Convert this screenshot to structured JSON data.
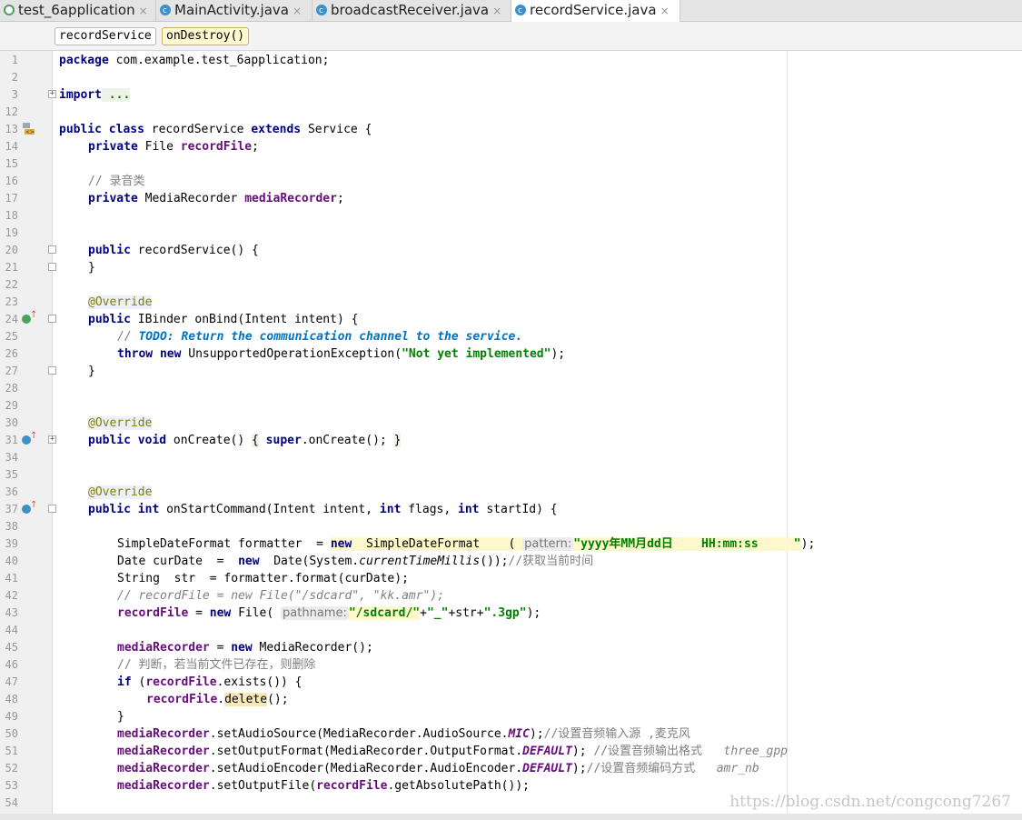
{
  "tabs": [
    {
      "label": "test_6application",
      "close": "×"
    },
    {
      "label": "MainActivity.java",
      "close": "×"
    },
    {
      "label": "broadcastReceiver.java",
      "close": "×"
    },
    {
      "label": "recordService.java",
      "close": "×"
    }
  ],
  "breadcrumb": [
    "recordService",
    "onDestroy()"
  ],
  "line_numbers": [
    "1",
    "2",
    "3",
    "12",
    "13",
    "14",
    "15",
    "16",
    "17",
    "18",
    "19",
    "20",
    "21",
    "22",
    "23",
    "24",
    "25",
    "26",
    "27",
    "28",
    "29",
    "30",
    "31",
    "34",
    "35",
    "36",
    "37",
    "38",
    "39",
    "40",
    "41",
    "42",
    "43",
    "44",
    "45",
    "46",
    "47",
    "48",
    "49",
    "50",
    "51",
    "52",
    "53",
    "54"
  ],
  "code": {
    "l1_kw": "package",
    "l1_rest": " com.example.test_6application;",
    "l3_kw": "import",
    "l3_rest": " ...",
    "l13_a": "public class",
    "l13_b": " recordService ",
    "l13_c": "extends",
    "l13_d": " Service {",
    "l14_kw": "private",
    "l14_type": " File ",
    "l14_fld": "recordFile",
    "l14_end": ";",
    "l16_cmt": "// 录音类",
    "l17_kw": "private",
    "l17_type": " MediaRecorder ",
    "l17_fld": "mediaRecorder",
    "l17_end": ";",
    "l20_kw": "public",
    "l20_rest": " recordService() {",
    "l21": "}",
    "l23_ann": "@Override",
    "l24_kw": "public",
    "l24_rest": " IBinder onBind(Intent intent) {",
    "l25_slash": "// ",
    "l25_todo": "TODO: Return the communication channel to the service.",
    "l26_kw1": "throw",
    "l26_kw2": " new",
    "l26_mid": " UnsupportedOperationException(",
    "l26_str": "\"Not yet implemented\"",
    "l26_end": ");",
    "l27": "}",
    "l30_ann": "@Override",
    "l31_kw": "public void",
    "l31_rest": " onCreate() ",
    "l31_b1": "{",
    "l31_sp": " ",
    "l31_super": "super",
    "l31_call": ".onCreate(); ",
    "l31_b2": "}",
    "l36_ann": "@Override",
    "l37_kw": "public int",
    "l37_a": " onStartCommand(Intent intent, ",
    "l37_kw2": "int",
    "l37_b": " flags, ",
    "l37_kw3": "int",
    "l37_c": " startId) {",
    "l39_a": "SimpleDateFormat formatter  = ",
    "l39_new": "new",
    "l39_b": "  SimpleDateFormat    ( ",
    "l39_hint": "pattern:",
    "l39_str": "\"yyyy年MM月dd日    HH:mm:ss     \"",
    "l39_end": ");",
    "l40_a": "Date curDate  =  ",
    "l40_new": "new",
    "l40_b": "  Date(System.",
    "l40_st": "currentTimeMillis",
    "l40_c": "());",
    "l40_cmt": "//获取当前时间",
    "l41": "String  str  = formatter.format(curDate);",
    "l42_cmt": "// recordFile = new File(\"/sdcard\", \"kk.amr\");",
    "l43_fld": "recordFile",
    "l43_a": " = ",
    "l43_new": "new",
    "l43_b": " File( ",
    "l43_hint": "pathname:",
    "l43_str1": "\"/sdcard/\"",
    "l43_c": "+",
    "l43_str2": "\"_\"",
    "l43_d": "+str+",
    "l43_str3": "\".3gp\"",
    "l43_end": ");",
    "l45_fld": "mediaRecorder",
    "l45_a": " = ",
    "l45_new": "new",
    "l45_b": " MediaRecorder();",
    "l46_cmt": "// 判断，若当前文件已存在，则删除",
    "l47_kw": "if",
    "l47_a": " (",
    "l47_fld": "recordFile",
    "l47_b": ".exists()) {",
    "l48_fld": "recordFile",
    "l48_a": ".",
    "l48_del": "delete",
    "l48_b": "();",
    "l49": "}",
    "l50_fld": "mediaRecorder",
    "l50_a": ".setAudioSource(MediaRecorder.AudioSource.",
    "l50_st": "MIC",
    "l50_b": ");",
    "l50_cmt": "//设置音频输入源 ,麦克风",
    "l51_fld": "mediaRecorder",
    "l51_a": ".setOutputFormat(MediaRecorder.OutputFormat.",
    "l51_st": "DEFAULT",
    "l51_b": "); ",
    "l51_cmt": "//设置音频输出格式",
    "l51_ic": "   three_gpp",
    "l52_fld": "mediaRecorder",
    "l52_a": ".setAudioEncoder(MediaRecorder.AudioEncoder.",
    "l52_st": "DEFAULT",
    "l52_b": ");",
    "l52_cmt": "//设置音频编码方式",
    "l52_ic": "   amr_nb",
    "l53_fld": "mediaRecorder",
    "l53_a": ".setOutputFile(",
    "l53_fld2": "recordFile",
    "l53_b": ".getAbsolutePath());"
  },
  "watermark": "https://blog.csdn.net/congcong7267"
}
